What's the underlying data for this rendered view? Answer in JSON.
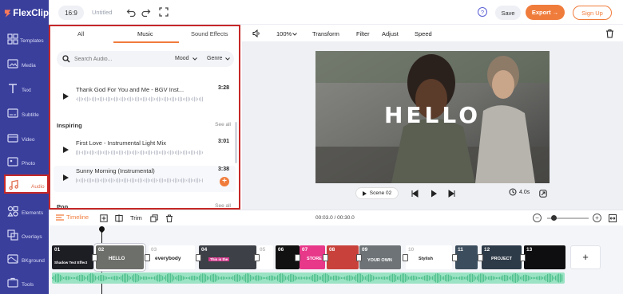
{
  "app": {
    "name": "FlexClip"
  },
  "topbar": {
    "ratio": "16:9",
    "title": "Untitled",
    "save": "Save",
    "export": "Export →",
    "signup": "Sign Up"
  },
  "sidebar": {
    "items": [
      {
        "label": "Templates",
        "icon": "templates-icon"
      },
      {
        "label": "Media",
        "icon": "media-icon"
      },
      {
        "label": "Text",
        "icon": "text-icon"
      },
      {
        "label": "Subtitle",
        "icon": "subtitle-icon"
      },
      {
        "label": "Video",
        "icon": "video-icon"
      },
      {
        "label": "Photo",
        "icon": "photo-icon"
      },
      {
        "label": "Audio",
        "icon": "music-note-icon",
        "active": true
      },
      {
        "label": "Elements",
        "icon": "elements-icon"
      },
      {
        "label": "Overlays",
        "icon": "overlays-icon"
      },
      {
        "label": "BKground",
        "icon": "background-icon"
      },
      {
        "label": "Tools",
        "icon": "tools-icon"
      }
    ]
  },
  "audio_panel": {
    "tabs": [
      "All",
      "Music",
      "Sound Effects"
    ],
    "active_tab": "Music",
    "search_placeholder": "Search Audio...",
    "filters": [
      "Mood",
      "Genre"
    ],
    "tracks": [
      {
        "name": "Thank God For You and Me - BGV Inst...",
        "duration": "3:28"
      },
      {
        "name": "First Love - Instrumental Light Mix",
        "duration": "3:01"
      },
      {
        "name": "Sunny Morning (Instrumental)",
        "duration": "3:38"
      }
    ],
    "sections": [
      {
        "title": "Inspiring",
        "see_all": "See all"
      },
      {
        "title": "Pop",
        "see_all": "See all"
      }
    ]
  },
  "preview_toolbar": {
    "zoom": "100%",
    "tools": [
      "Transform",
      "Filter",
      "Adjust",
      "Speed"
    ]
  },
  "preview": {
    "overlay_text": "HELLO",
    "scene": "Scene 02",
    "duration": "4.0s"
  },
  "timeline": {
    "label": "Timeline",
    "trim": "Trim",
    "time": "00:03.0 / 00:30.0",
    "zoom_level": 0.15,
    "clips": [
      {
        "num": "01",
        "caption": "Shadow Text Effect"
      },
      {
        "num": "02",
        "caption": "HELLO"
      },
      {
        "num": "03",
        "caption": "everybody"
      },
      {
        "num": "04",
        "caption": "This is the"
      },
      {
        "num": "05",
        "caption": ""
      },
      {
        "num": "06",
        "caption": ""
      },
      {
        "num": "07",
        "caption": "STORE"
      },
      {
        "num": "08",
        "caption": ""
      },
      {
        "num": "09",
        "caption": "YOUR OWN"
      },
      {
        "num": "10",
        "caption": "Stylish"
      },
      {
        "num": "11",
        "caption": ""
      },
      {
        "num": "12",
        "caption": "PROJECT"
      },
      {
        "num": "13",
        "caption": ""
      }
    ]
  },
  "colors": {
    "sidebar": "#3a3f9c",
    "accent": "#f07c3c",
    "highlight_border": "#c62828",
    "audio_wave": "#9be3c4"
  }
}
